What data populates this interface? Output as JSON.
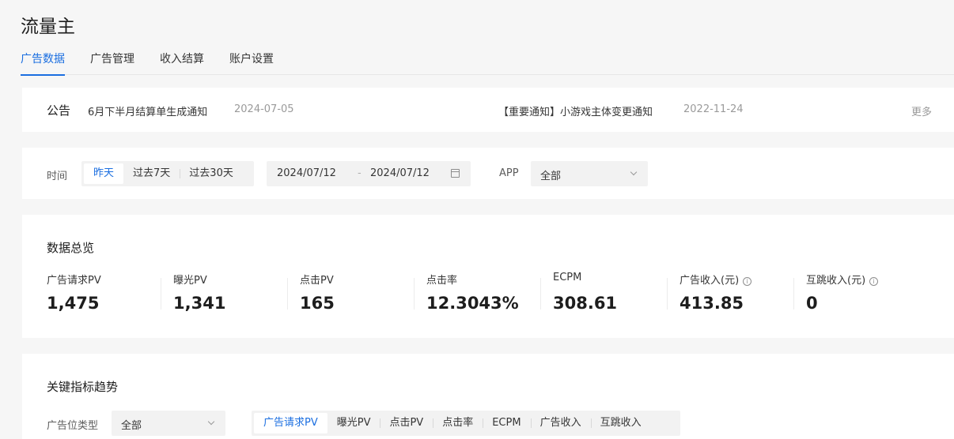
{
  "app": {
    "title": "流量主"
  },
  "tabs": [
    {
      "label": "广告数据",
      "active": true
    },
    {
      "label": "广告管理",
      "active": false
    },
    {
      "label": "收入结算",
      "active": false
    },
    {
      "label": "账户设置",
      "active": false
    }
  ],
  "notice": {
    "label": "公告",
    "items": [
      {
        "title": "6月下半月结算单生成通知",
        "date": "2024-07-05"
      },
      {
        "title": "【重要通知】小游戏主体变更通知",
        "date": "2022-11-24"
      }
    ],
    "more": "更多"
  },
  "filters": {
    "time_label": "时间",
    "time_options": [
      "昨天",
      "过去7天",
      "过去30天"
    ],
    "time_selected": "昨天",
    "date_start": "2024/07/12",
    "date_sep": "-",
    "date_end": "2024/07/12",
    "app_label": "APP",
    "app_value": "全部"
  },
  "overview": {
    "title": "数据总览",
    "metrics": [
      {
        "label": "广告请求PV",
        "value": "1,475"
      },
      {
        "label": "曝光PV",
        "value": "1,341"
      },
      {
        "label": "点击PV",
        "value": "165"
      },
      {
        "label": "点击率",
        "value": "12.3043%"
      },
      {
        "label": "ECPM",
        "value": "308.61"
      },
      {
        "label": "广告收入(元)",
        "value": "413.85",
        "info": true
      },
      {
        "label": "互跳收入(元)",
        "value": "0",
        "info": true
      }
    ]
  },
  "trend": {
    "title": "关键指标趋势",
    "slot_type_label": "广告位类型",
    "slot_type_value": "全部",
    "metric_options": [
      "广告请求PV",
      "曝光PV",
      "点击PV",
      "点击率",
      "ECPM",
      "广告收入",
      "互跳收入"
    ],
    "metric_selected": "广告请求PV"
  },
  "icons": {
    "info": "info-icon",
    "calendar": "calendar-icon",
    "dropdown": "chevron-down-icon"
  },
  "colors": {
    "accent": "#1a6ee0"
  }
}
